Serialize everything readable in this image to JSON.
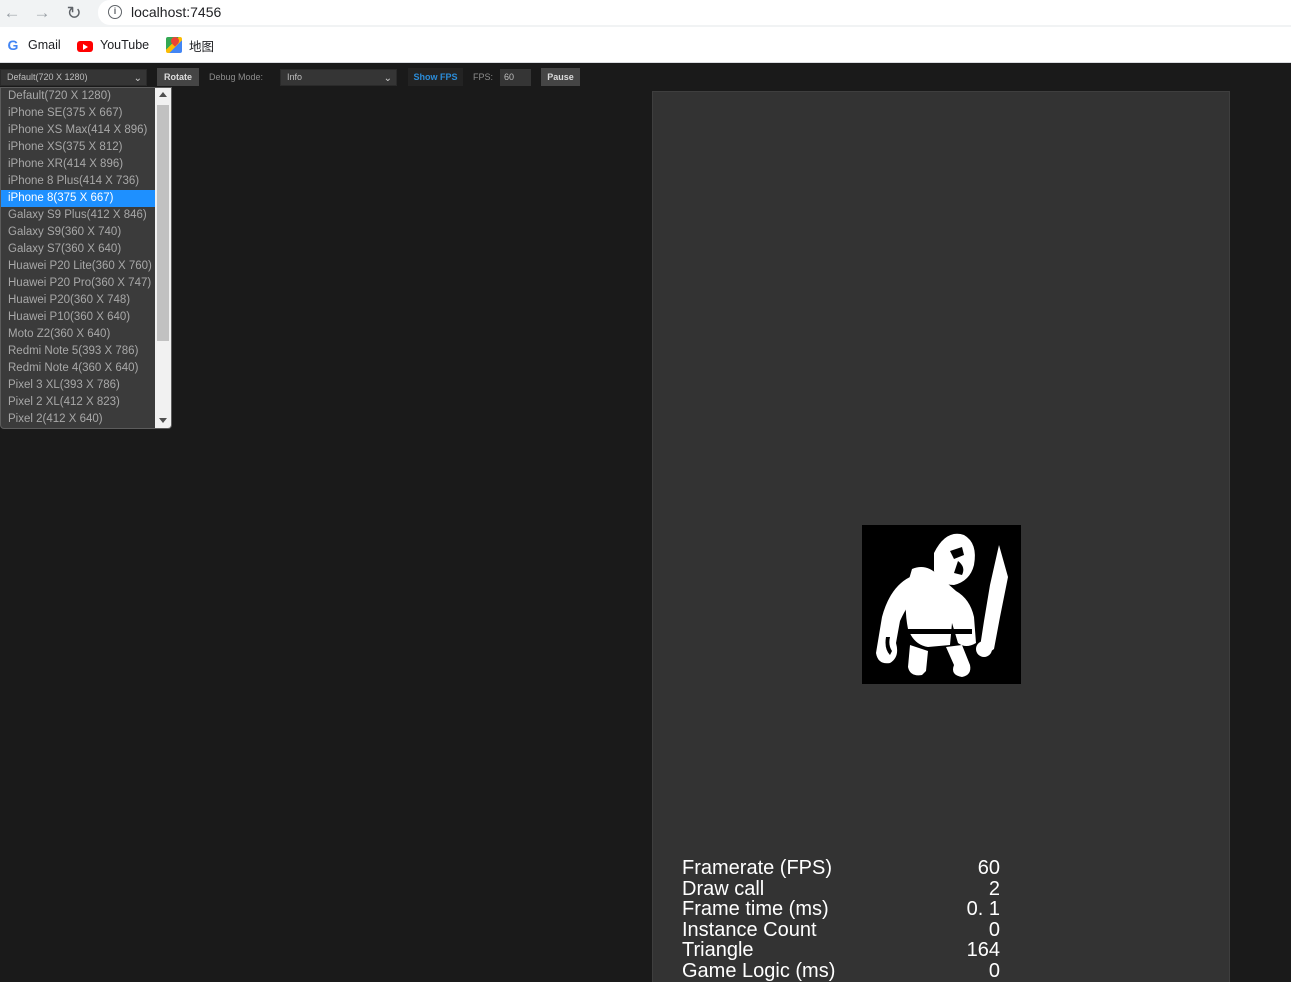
{
  "browser": {
    "url": "localhost:7456",
    "bookmarks": [
      {
        "label": "Gmail",
        "icon": "google-icon"
      },
      {
        "label": "YouTube",
        "icon": "youtube-icon"
      },
      {
        "label": "地图",
        "icon": "maps-icon"
      }
    ]
  },
  "toolbar": {
    "device_value": "Default(720 X 1280)",
    "rotate_label": "Rotate",
    "debug_mode_label": "Debug Mode:",
    "debug_mode_value": "Info",
    "show_fps_label": "Show FPS",
    "fps_label": "FPS:",
    "fps_value": "60",
    "pause_label": "Pause"
  },
  "device_dropdown": {
    "selected_index": 6,
    "options": [
      "Default(720 X 1280)",
      "iPhone SE(375 X 667)",
      "iPhone XS Max(414 X 896)",
      "iPhone XS(375 X 812)",
      "iPhone XR(414 X 896)",
      "iPhone 8 Plus(414 X 736)",
      "iPhone 8(375 X 667)",
      "Galaxy S9 Plus(412 X 846)",
      "Galaxy S9(360 X 740)",
      "Galaxy S7(360 X 640)",
      "Huawei P20 Lite(360 X 760)",
      "Huawei P20 Pro(360 X 747)",
      "Huawei P20(360 X 748)",
      "Huawei P10(360 X 640)",
      "Moto Z2(360 X 640)",
      "Redmi Note 5(393 X 786)",
      "Redmi Note 4(360 X 640)",
      "Pixel 3 XL(393 X 786)",
      "Pixel 2 XL(412 X 823)",
      "Pixel 2(412 X 640)"
    ]
  },
  "stats": [
    {
      "label": "Framerate (FPS)",
      "value": "60"
    },
    {
      "label": "Draw call",
      "value": "2"
    },
    {
      "label": "Frame time (ms)",
      "value": "0. 1"
    },
    {
      "label": "Instance Count",
      "value": "0"
    },
    {
      "label": "Triangle",
      "value": "164"
    },
    {
      "label": "Game Logic (ms)",
      "value": "0"
    }
  ]
}
